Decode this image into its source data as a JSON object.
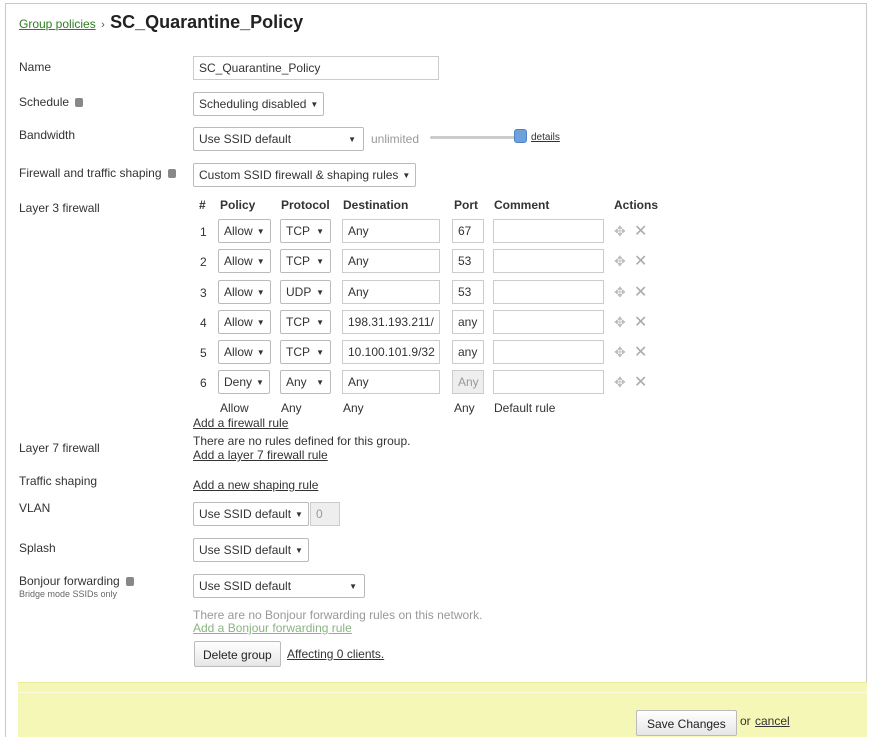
{
  "breadcrumb": {
    "link": "Group policies",
    "separator": "›",
    "title": "SC_Quarantine_Policy"
  },
  "fields": {
    "name": {
      "label": "Name",
      "value": "SC_Quarantine_Policy"
    },
    "schedule": {
      "label": "Schedule",
      "value": "Scheduling disabled"
    },
    "bandwidth": {
      "label": "Bandwidth",
      "value": "Use SSID default",
      "limit_text": "unlimited",
      "details_link": "details",
      "slider_level_percent": 100
    },
    "firewall_shaping": {
      "label": "Firewall and traffic shaping",
      "value": "Custom SSID firewall & shaping rules"
    },
    "layer3": {
      "label": "Layer 3 firewall"
    },
    "layer7": {
      "label": "Layer 7 firewall",
      "empty_text": "There are no rules defined for this group.",
      "add_link": "Add a layer 7 firewall rule"
    },
    "traffic_shaping": {
      "label": "Traffic shaping",
      "add_link": "Add a new shaping rule"
    },
    "vlan": {
      "label": "VLAN",
      "value": "Use SSID default",
      "vlan_id": "0"
    },
    "splash": {
      "label": "Splash",
      "value": "Use SSID default"
    },
    "bonjour": {
      "label": "Bonjour forwarding",
      "sublabel": "Bridge mode SSIDs only",
      "value": "Use SSID default",
      "empty_text": "There are no Bonjour forwarding rules on this network.",
      "add_link": "Add a Bonjour forwarding rule"
    }
  },
  "firewall_table": {
    "headers": {
      "num": "#",
      "policy": "Policy",
      "protocol": "Protocol",
      "destination": "Destination",
      "port": "Port",
      "comment": "Comment",
      "actions": "Actions"
    },
    "rows": [
      {
        "num": "1",
        "policy": "Allow",
        "protocol": "TCP",
        "destination": "Any",
        "port": "67",
        "comment": ""
      },
      {
        "num": "2",
        "policy": "Allow",
        "protocol": "TCP",
        "destination": "Any",
        "port": "53",
        "comment": ""
      },
      {
        "num": "3",
        "policy": "Allow",
        "protocol": "UDP",
        "destination": "Any",
        "port": "53",
        "comment": ""
      },
      {
        "num": "4",
        "policy": "Allow",
        "protocol": "TCP",
        "destination": "198.31.193.211/",
        "port": "any",
        "comment": ""
      },
      {
        "num": "5",
        "policy": "Allow",
        "protocol": "TCP",
        "destination": "10.100.101.9/32",
        "port": "any",
        "comment": ""
      },
      {
        "num": "6",
        "policy": "Deny",
        "protocol": "Any",
        "destination": "Any",
        "port": "Any",
        "comment": ""
      }
    ],
    "default_rule": {
      "policy": "Allow",
      "protocol": "Any",
      "destination": "Any",
      "port": "Any",
      "comment": "Default rule"
    },
    "add_link": "Add a firewall rule"
  },
  "actions": {
    "delete_group": "Delete group",
    "affecting": "Affecting 0 clients."
  },
  "footer": {
    "save": "Save Changes",
    "or": "or",
    "cancel": "cancel"
  },
  "icons": {
    "info": "info-icon",
    "move": "move-icon",
    "delete": "close-icon",
    "caret": "caret-down-icon"
  },
  "colors": {
    "link": "#2e7d1f",
    "footer_bg": "#f5f7b6",
    "slider_knob": "#6fa0dc"
  }
}
